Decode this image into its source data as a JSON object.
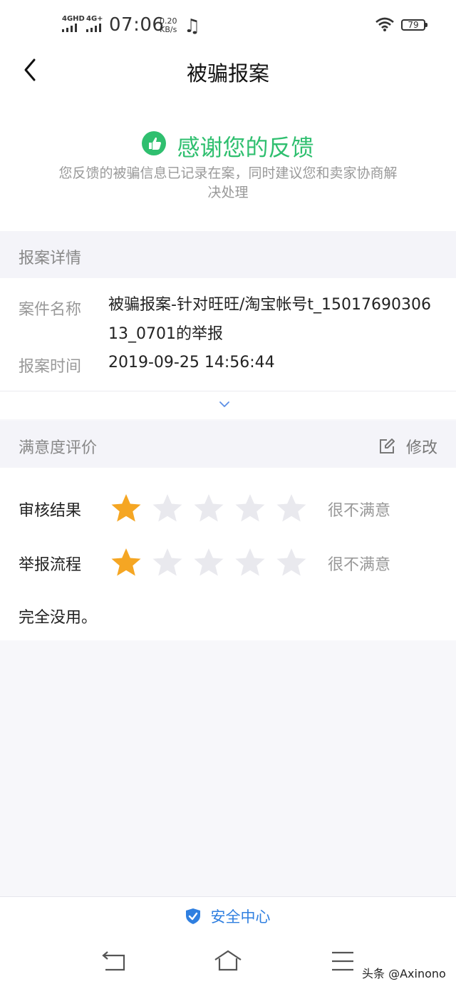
{
  "status_bar": {
    "net1": "4GHD",
    "net2": "4G+",
    "time": "07:06",
    "speed_value": "0.20",
    "speed_unit": "KB/s",
    "battery": "79"
  },
  "header": {
    "title": "被骗报案"
  },
  "feedback": {
    "title": "感谢您的反馈",
    "description": "您反馈的被骗信息已记录在案，同时建议您和卖家协商解决处理"
  },
  "details": {
    "section_title": "报案详情",
    "case_name_label": "案件名称",
    "case_name_value": "被骗报案-针对旺旺/淘宝帐号t_1501769030613_0701的举报",
    "case_time_label": "报案时间",
    "case_time_value": "2019-09-25 14:56:44"
  },
  "rating": {
    "section_title": "满意度评价",
    "edit_label": "修改",
    "rows": [
      {
        "label": "审核结果",
        "stars": 1,
        "max_stars": 5,
        "text": "很不满意"
      },
      {
        "label": "举报流程",
        "stars": 1,
        "max_stars": 5,
        "text": "很不满意"
      }
    ],
    "comment": "完全没用。"
  },
  "bottom": {
    "security_center_label": "安全中心"
  },
  "watermark": "头条 @Axinono",
  "colors": {
    "accent_green": "#2fbf6f",
    "star_filled": "#f5a623",
    "star_empty": "#e9e9ee",
    "link_blue": "#2f7fe0"
  },
  "icons": [
    "back-arrow-icon",
    "thumbs-up-icon",
    "chevron-down-icon",
    "edit-icon",
    "star-icon",
    "shield-icon",
    "back-nav-icon",
    "home-nav-icon",
    "menu-nav-icon"
  ]
}
